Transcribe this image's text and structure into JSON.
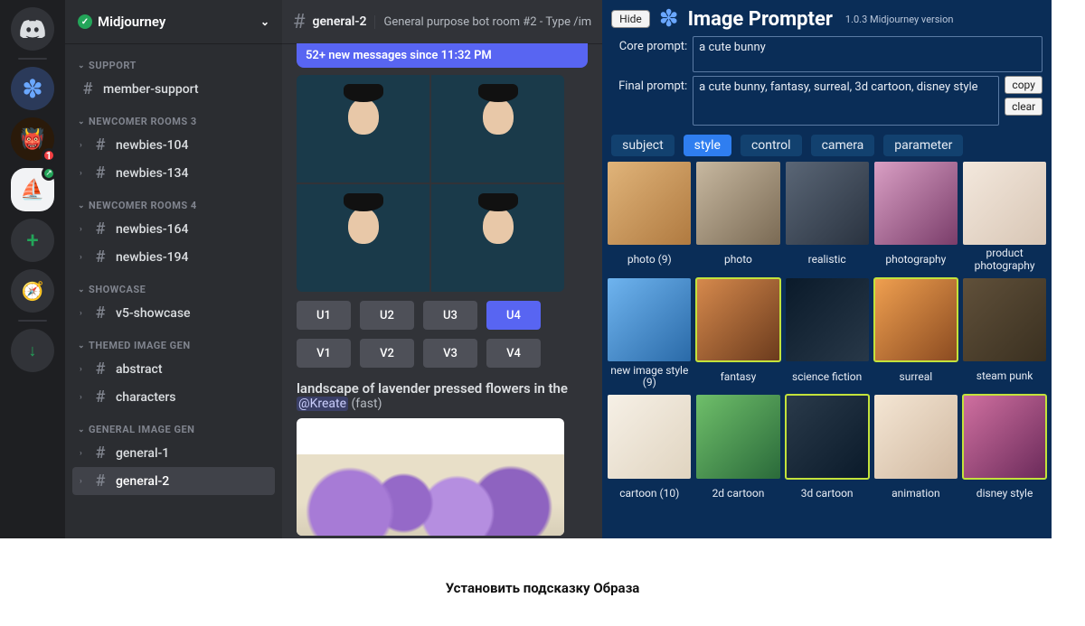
{
  "discord": {
    "rail": {
      "home_badge": null,
      "server_badge": "1"
    },
    "server_name": "Midjourney",
    "categories": [
      {
        "name": "SUPPORT",
        "channels": [
          {
            "name": "member-support",
            "bright": true,
            "locked": true,
            "caret": false
          }
        ]
      },
      {
        "name": "NEWCOMER ROOMS 3",
        "channels": [
          {
            "name": "newbies-104",
            "bright": true,
            "locked": true,
            "caret": true
          },
          {
            "name": "newbies-134",
            "bright": true,
            "locked": true,
            "caret": true
          }
        ]
      },
      {
        "name": "NEWCOMER ROOMS 4",
        "channels": [
          {
            "name": "newbies-164",
            "bright": true,
            "locked": true,
            "caret": true
          },
          {
            "name": "newbies-194",
            "bright": true,
            "locked": true,
            "caret": true
          }
        ]
      },
      {
        "name": "SHOWCASE",
        "channels": [
          {
            "name": "v5-showcase",
            "bright": true,
            "locked": false,
            "caret": true
          }
        ]
      },
      {
        "name": "THEMED IMAGE GEN",
        "channels": [
          {
            "name": "abstract",
            "bright": true,
            "locked": false,
            "caret": true
          },
          {
            "name": "characters",
            "bright": true,
            "locked": false,
            "caret": true
          }
        ]
      },
      {
        "name": "GENERAL IMAGE GEN",
        "channels": [
          {
            "name": "general-1",
            "bright": true,
            "locked": false,
            "caret": true
          },
          {
            "name": "general-2",
            "bright": true,
            "locked": false,
            "caret": true,
            "active": true
          }
        ]
      }
    ],
    "chat": {
      "channel": "general-2",
      "description": "General purpose bot room #2 - Type /im",
      "new_messages": "52+ new messages since 11:32 PM",
      "u_buttons": [
        "U1",
        "U2",
        "U3",
        "U4"
      ],
      "v_buttons": [
        "V1",
        "V2",
        "V3",
        "V4"
      ],
      "u_active_index": 3,
      "prompt_line": "landscape of lavender pressed flowers in the",
      "mention": "@Kreate",
      "mention_suffix": "(fast)"
    }
  },
  "prompter": {
    "hide": "Hide",
    "title": "Image Prompter",
    "version": "1.0.3 Midjourney version",
    "core_label": "Core prompt:",
    "core_value": "a cute bunny",
    "final_label": "Final prompt:",
    "final_value": "a cute bunny, fantasy, surreal, 3d cartoon, disney style",
    "copy": "copy",
    "clear": "clear",
    "tabs": [
      "subject",
      "style",
      "control",
      "camera",
      "parameter"
    ],
    "active_tab_index": 1,
    "thumbs": [
      {
        "cap": "photo (9)",
        "g": "g1",
        "sel": false
      },
      {
        "cap": "photo",
        "g": "g2",
        "sel": false
      },
      {
        "cap": "realistic",
        "g": "g3",
        "sel": false
      },
      {
        "cap": "photography",
        "g": "g4",
        "sel": false
      },
      {
        "cap": "product photography",
        "g": "g5",
        "sel": false
      },
      {
        "cap": "new image style (9)",
        "g": "g6",
        "sel": false
      },
      {
        "cap": "fantasy",
        "g": "g7",
        "sel": true
      },
      {
        "cap": "science fiction",
        "g": "g8",
        "sel": false
      },
      {
        "cap": "surreal",
        "g": "g9",
        "sel": true
      },
      {
        "cap": "steam punk",
        "g": "g10",
        "sel": false
      },
      {
        "cap": "cartoon (10)",
        "g": "g11",
        "sel": false
      },
      {
        "cap": "2d cartoon",
        "g": "g12",
        "sel": false
      },
      {
        "cap": "3d cartoon",
        "g": "g13",
        "sel": true
      },
      {
        "cap": "animation",
        "g": "g14",
        "sel": false
      },
      {
        "cap": "disney style",
        "g": "g15",
        "sel": true
      }
    ]
  },
  "caption": "Установить подсказку Образа"
}
